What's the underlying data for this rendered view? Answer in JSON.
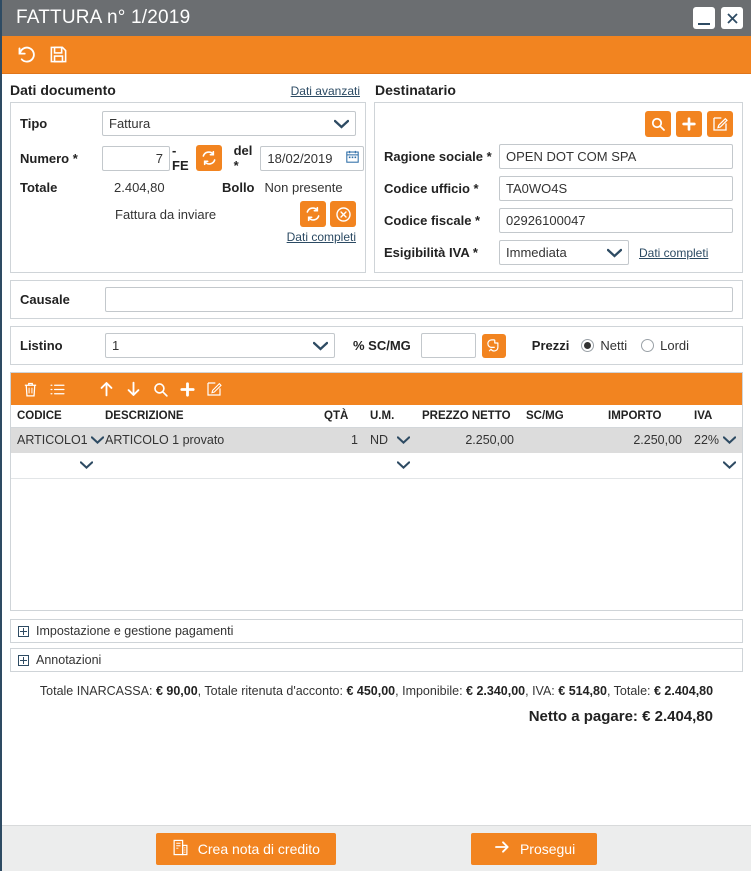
{
  "window": {
    "title": "FATTURA n° 1/2019",
    "minimize_label": "—",
    "close_label": "✕"
  },
  "app_toolbar": {
    "undo_icon": "undo-icon",
    "save_icon": "save-icon"
  },
  "sections": {
    "dati_documento_title": "Dati documento",
    "dati_avanzati_link": "Dati avanzati",
    "destinatario_title": "Destinatario"
  },
  "dati_documento": {
    "tipo_label": "Tipo",
    "tipo_value": "Fattura",
    "numero_label": "Numero *",
    "numero_value": "7",
    "numero_suffix": "-FE",
    "del_label": "del *",
    "del_value": "18/02/2019",
    "totale_label": "Totale",
    "totale_value": "2.404,80",
    "bollo_label": "Bollo",
    "bollo_value": "Non presente",
    "stato_invio": "Fattura da inviare",
    "dati_completi_link": "Dati completi"
  },
  "destinatario": {
    "ragione_sociale_label": "Ragione sociale *",
    "ragione_sociale_value": "OPEN DOT COM SPA",
    "codice_ufficio_label": "Codice ufficio *",
    "codice_ufficio_value": "TA0WO4S",
    "codice_fiscale_label": "Codice fiscale *",
    "codice_fiscale_value": "02926100047",
    "esigibilita_label": "Esigibilità IVA *",
    "esigibilita_value": "Immediata",
    "dati_completi_link": "Dati completi"
  },
  "causale": {
    "label": "Causale",
    "value": "",
    "placeholder": ""
  },
  "listino": {
    "label": "Listino",
    "value": "1",
    "scmg_label": "% SC/MG",
    "scmg_value": "",
    "prezzi_label": "Prezzi",
    "netti_label": "Netti",
    "lordi_label": "Lordi",
    "selected": "Netti"
  },
  "grid": {
    "toolbar_icons": [
      "trash-icon",
      "list-icon",
      "arrow-up-icon",
      "arrow-down-icon",
      "search-icon",
      "plus-icon",
      "edit-icon"
    ],
    "columns": [
      "CODICE",
      "DESCRIZIONE",
      "QTÀ",
      "U.M.",
      "PREZZO NETTO",
      "SC/MG",
      "IMPORTO",
      "IVA"
    ],
    "rows": [
      {
        "codice": "ARTICOLO1",
        "descrizione": "ARTICOLO 1 provato",
        "qta": "1",
        "um": "ND",
        "prezzo_netto": "2.250,00",
        "scmg": "",
        "importo": "2.250,00",
        "iva": "22%"
      },
      {
        "codice": "",
        "descrizione": "",
        "qta": "",
        "um": "",
        "prezzo_netto": "",
        "scmg": "",
        "importo": "",
        "iva": ""
      }
    ]
  },
  "collapsibles": {
    "pagamenti_label": "Impostazione e gestione pagamenti",
    "annotazioni_label": "Annotazioni"
  },
  "totals": {
    "inarcassa_label": "Totale INARCASSA:",
    "inarcassa_value": "€ 90,00",
    "ritenuta_label": "Totale ritenuta d'acconto:",
    "ritenuta_value": "€ 450,00",
    "imponibile_label": "Imponibile:",
    "imponibile_value": "€ 2.340,00",
    "iva_label": "IVA:",
    "iva_value": "€ 514,80",
    "totale_label": "Totale:",
    "totale_value": "€ 2.404,80",
    "netto_label": "Netto a pagare:",
    "netto_value": "€ 2.404,80"
  },
  "footer": {
    "nota_credito_label": "Crea nota di credito",
    "prosegui_label": "Prosegui"
  },
  "colors": {
    "orange": "#f28420",
    "titlebar_gray": "#6b6e71",
    "navy": "#2e4b63",
    "row_selected": "#dcdcdc"
  }
}
